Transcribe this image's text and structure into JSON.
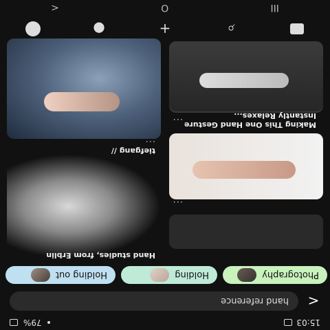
{
  "status": {
    "time": "15:03",
    "battery": "79%"
  },
  "search": {
    "query": "hand reference",
    "back_glyph": "<"
  },
  "chips": [
    {
      "label": "Photography"
    },
    {
      "label": "Holding"
    },
    {
      "label": "Holding out"
    }
  ],
  "pins": {
    "left_caption_1": "Hand studies, from Erblin",
    "left_caption_2": "tiefgang //",
    "right_caption_1": "Making This One Hand Gesture Instantly Relaxes...",
    "more": "..."
  },
  "nav": {
    "items": [
      "home",
      "search",
      "create",
      "notifications",
      "profile"
    ]
  },
  "sys": {
    "recents": "III",
    "home": "O",
    "back": "<"
  }
}
